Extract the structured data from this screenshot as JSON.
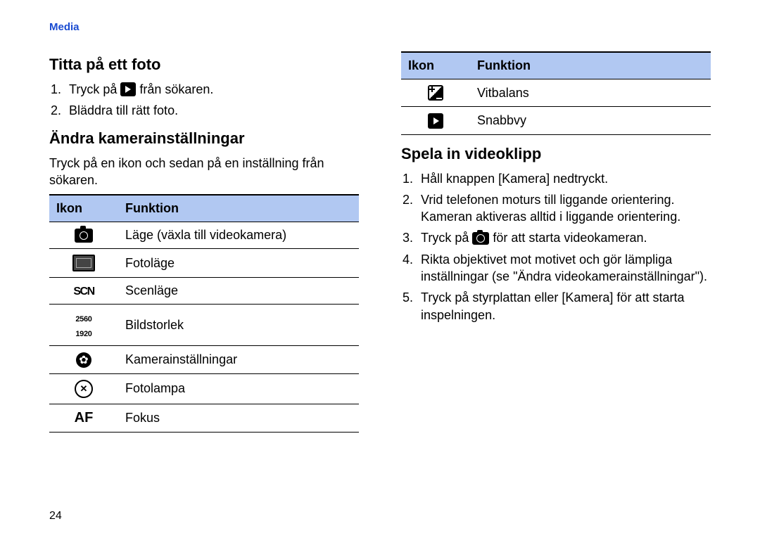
{
  "header": "Media",
  "left": {
    "h_view": "Titta på ett foto",
    "view_steps": [
      {
        "before": "Tryck på ",
        "icon": "play",
        "after": " från sökaren."
      },
      {
        "text": "Bläddra till rätt foto."
      }
    ],
    "h_settings": "Ändra kamerainställningar",
    "settings_intro": "Tryck på en ikon och sedan på en inställning från sökaren.",
    "table": {
      "head_icon": "Ikon",
      "head_func": "Funktion",
      "rows": [
        {
          "icon": "camera",
          "name": "mode-icon",
          "label": "Läge (växla till videokamera)"
        },
        {
          "icon": "screen",
          "name": "photo-mode-icon",
          "label": "Fotoläge"
        },
        {
          "icon": "scn",
          "name": "scene-mode-icon",
          "label": "Scenläge"
        },
        {
          "icon": "res",
          "name": "image-size-icon",
          "label": "Bildstorlek"
        },
        {
          "icon": "gear-dark",
          "name": "camera-settings-icon",
          "label": "Kamerainställningar"
        },
        {
          "icon": "gear-cross",
          "name": "flash-icon",
          "label": "Fotolampa"
        },
        {
          "icon": "af",
          "name": "focus-icon",
          "label": "Fokus"
        }
      ]
    }
  },
  "right": {
    "table": {
      "head_icon": "Ikon",
      "head_func": "Funktion",
      "rows": [
        {
          "icon": "exposure",
          "name": "white-balance-icon",
          "label": "Vitbalans"
        },
        {
          "icon": "play",
          "name": "quick-view-icon",
          "label": "Snabbvy"
        }
      ]
    },
    "h_record": "Spela in videoklipp",
    "record_steps": [
      {
        "text": "Håll knappen [Kamera] nedtryckt."
      },
      {
        "text": "Vrid telefonen moturs till liggande orientering.",
        "extra": "Kameran aktiveras alltid i liggande orientering."
      },
      {
        "before": "Tryck på ",
        "icon": "camera",
        "after": " för att starta videokameran."
      },
      {
        "text": "Rikta objektivet mot motivet och gör lämpliga inställningar (se \"Ändra videokamerainställningar\")."
      },
      {
        "text": "Tryck på styrplattan eller [Kamera] för att starta inspelningen."
      }
    ]
  },
  "page_number": "24",
  "res_text": {
    "top": "2560",
    "bottom": "1920"
  },
  "scn_text": "SCN",
  "af_text": "AF"
}
